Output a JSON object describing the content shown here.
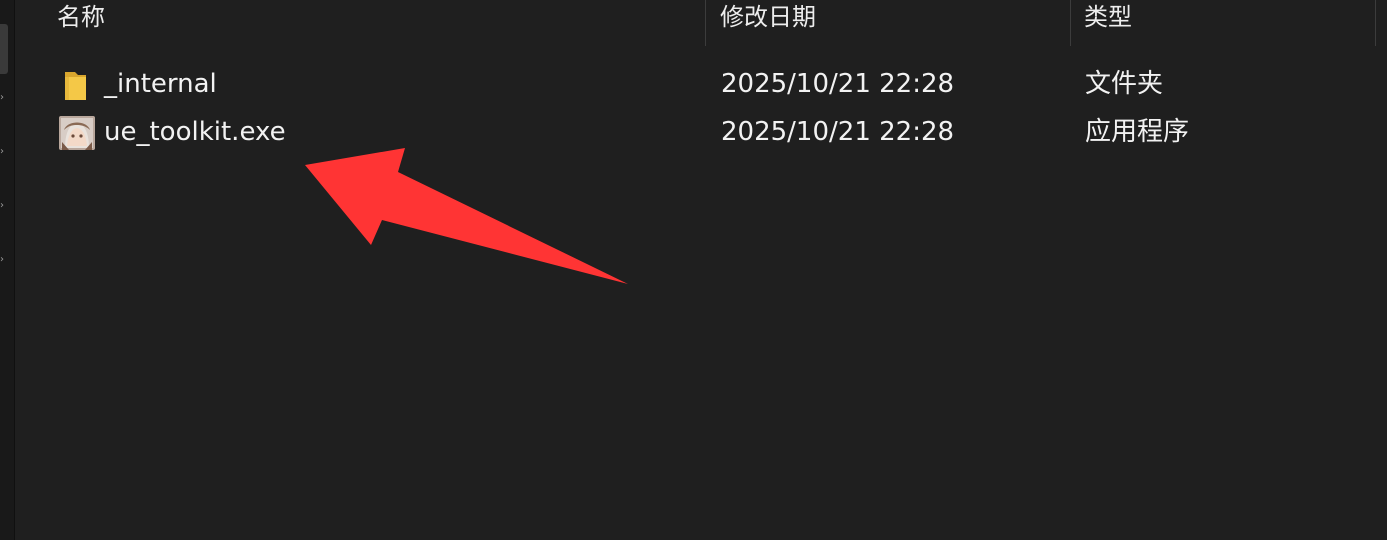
{
  "columns": {
    "name": "名称",
    "modified": "修改日期",
    "type": "类型"
  },
  "files": [
    {
      "icon": "folder-icon",
      "name": "_internal",
      "modified": "2025/10/21 22:28",
      "type": "文件夹"
    },
    {
      "icon": "app-icon",
      "name": "ue_toolkit.exe",
      "modified": "2025/10/21 22:28",
      "type": "应用程序"
    }
  ],
  "colors": {
    "background": "#1f1f1f",
    "text": "#f2f2f2",
    "folder": "#f4c847",
    "annotation_arrow": "#ff3333"
  }
}
